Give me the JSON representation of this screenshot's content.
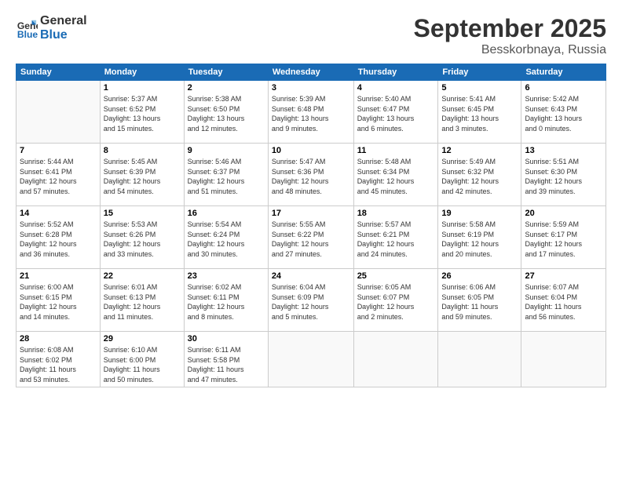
{
  "header": {
    "logo_line1": "General",
    "logo_line2": "Blue",
    "month": "September 2025",
    "location": "Besskorbnaya, Russia"
  },
  "days_of_week": [
    "Sunday",
    "Monday",
    "Tuesday",
    "Wednesday",
    "Thursday",
    "Friday",
    "Saturday"
  ],
  "weeks": [
    [
      {
        "day": "",
        "info": ""
      },
      {
        "day": "1",
        "info": "Sunrise: 5:37 AM\nSunset: 6:52 PM\nDaylight: 13 hours\nand 15 minutes."
      },
      {
        "day": "2",
        "info": "Sunrise: 5:38 AM\nSunset: 6:50 PM\nDaylight: 13 hours\nand 12 minutes."
      },
      {
        "day": "3",
        "info": "Sunrise: 5:39 AM\nSunset: 6:48 PM\nDaylight: 13 hours\nand 9 minutes."
      },
      {
        "day": "4",
        "info": "Sunrise: 5:40 AM\nSunset: 6:47 PM\nDaylight: 13 hours\nand 6 minutes."
      },
      {
        "day": "5",
        "info": "Sunrise: 5:41 AM\nSunset: 6:45 PM\nDaylight: 13 hours\nand 3 minutes."
      },
      {
        "day": "6",
        "info": "Sunrise: 5:42 AM\nSunset: 6:43 PM\nDaylight: 13 hours\nand 0 minutes."
      }
    ],
    [
      {
        "day": "7",
        "info": "Sunrise: 5:44 AM\nSunset: 6:41 PM\nDaylight: 12 hours\nand 57 minutes."
      },
      {
        "day": "8",
        "info": "Sunrise: 5:45 AM\nSunset: 6:39 PM\nDaylight: 12 hours\nand 54 minutes."
      },
      {
        "day": "9",
        "info": "Sunrise: 5:46 AM\nSunset: 6:37 PM\nDaylight: 12 hours\nand 51 minutes."
      },
      {
        "day": "10",
        "info": "Sunrise: 5:47 AM\nSunset: 6:36 PM\nDaylight: 12 hours\nand 48 minutes."
      },
      {
        "day": "11",
        "info": "Sunrise: 5:48 AM\nSunset: 6:34 PM\nDaylight: 12 hours\nand 45 minutes."
      },
      {
        "day": "12",
        "info": "Sunrise: 5:49 AM\nSunset: 6:32 PM\nDaylight: 12 hours\nand 42 minutes."
      },
      {
        "day": "13",
        "info": "Sunrise: 5:51 AM\nSunset: 6:30 PM\nDaylight: 12 hours\nand 39 minutes."
      }
    ],
    [
      {
        "day": "14",
        "info": "Sunrise: 5:52 AM\nSunset: 6:28 PM\nDaylight: 12 hours\nand 36 minutes."
      },
      {
        "day": "15",
        "info": "Sunrise: 5:53 AM\nSunset: 6:26 PM\nDaylight: 12 hours\nand 33 minutes."
      },
      {
        "day": "16",
        "info": "Sunrise: 5:54 AM\nSunset: 6:24 PM\nDaylight: 12 hours\nand 30 minutes."
      },
      {
        "day": "17",
        "info": "Sunrise: 5:55 AM\nSunset: 6:22 PM\nDaylight: 12 hours\nand 27 minutes."
      },
      {
        "day": "18",
        "info": "Sunrise: 5:57 AM\nSunset: 6:21 PM\nDaylight: 12 hours\nand 24 minutes."
      },
      {
        "day": "19",
        "info": "Sunrise: 5:58 AM\nSunset: 6:19 PM\nDaylight: 12 hours\nand 20 minutes."
      },
      {
        "day": "20",
        "info": "Sunrise: 5:59 AM\nSunset: 6:17 PM\nDaylight: 12 hours\nand 17 minutes."
      }
    ],
    [
      {
        "day": "21",
        "info": "Sunrise: 6:00 AM\nSunset: 6:15 PM\nDaylight: 12 hours\nand 14 minutes."
      },
      {
        "day": "22",
        "info": "Sunrise: 6:01 AM\nSunset: 6:13 PM\nDaylight: 12 hours\nand 11 minutes."
      },
      {
        "day": "23",
        "info": "Sunrise: 6:02 AM\nSunset: 6:11 PM\nDaylight: 12 hours\nand 8 minutes."
      },
      {
        "day": "24",
        "info": "Sunrise: 6:04 AM\nSunset: 6:09 PM\nDaylight: 12 hours\nand 5 minutes."
      },
      {
        "day": "25",
        "info": "Sunrise: 6:05 AM\nSunset: 6:07 PM\nDaylight: 12 hours\nand 2 minutes."
      },
      {
        "day": "26",
        "info": "Sunrise: 6:06 AM\nSunset: 6:05 PM\nDaylight: 11 hours\nand 59 minutes."
      },
      {
        "day": "27",
        "info": "Sunrise: 6:07 AM\nSunset: 6:04 PM\nDaylight: 11 hours\nand 56 minutes."
      }
    ],
    [
      {
        "day": "28",
        "info": "Sunrise: 6:08 AM\nSunset: 6:02 PM\nDaylight: 11 hours\nand 53 minutes."
      },
      {
        "day": "29",
        "info": "Sunrise: 6:10 AM\nSunset: 6:00 PM\nDaylight: 11 hours\nand 50 minutes."
      },
      {
        "day": "30",
        "info": "Sunrise: 6:11 AM\nSunset: 5:58 PM\nDaylight: 11 hours\nand 47 minutes."
      },
      {
        "day": "",
        "info": ""
      },
      {
        "day": "",
        "info": ""
      },
      {
        "day": "",
        "info": ""
      },
      {
        "day": "",
        "info": ""
      }
    ]
  ]
}
